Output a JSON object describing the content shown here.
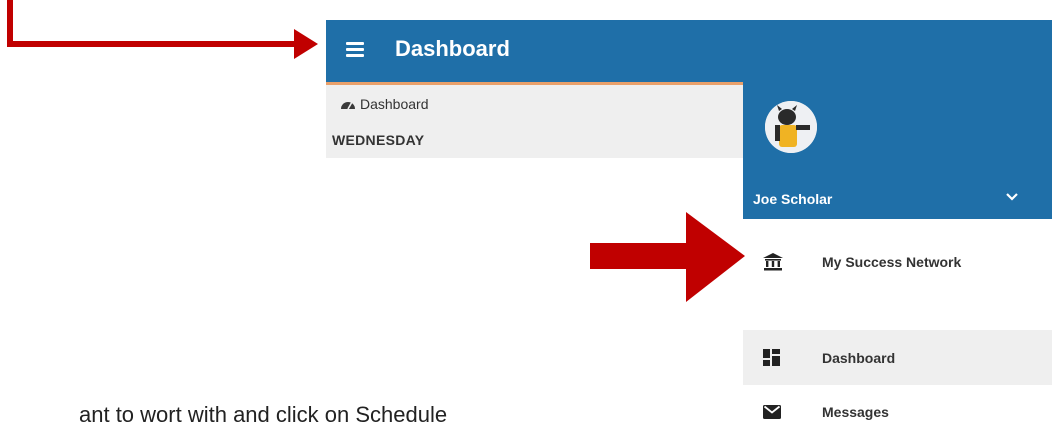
{
  "app_bar": {
    "title": "Dashboard"
  },
  "breadcrumb": {
    "label": "Dashboard",
    "day": "WEDNESDAY"
  },
  "drawer": {
    "user_name": "Joe Scholar",
    "items": [
      {
        "label": "My Success Network",
        "icon": "bank-icon"
      },
      {
        "label": "Dashboard",
        "icon": "dashboard-grid-icon"
      },
      {
        "label": "Messages",
        "icon": "envelope-icon"
      }
    ]
  },
  "document_text": {
    "line": "ant to wort with and click on Schedule"
  },
  "colors": {
    "app_bar": "#1f6fa8",
    "accent_line": "#e9a06a",
    "panel_gray": "#efefef",
    "arrow_red": "#c00000"
  }
}
